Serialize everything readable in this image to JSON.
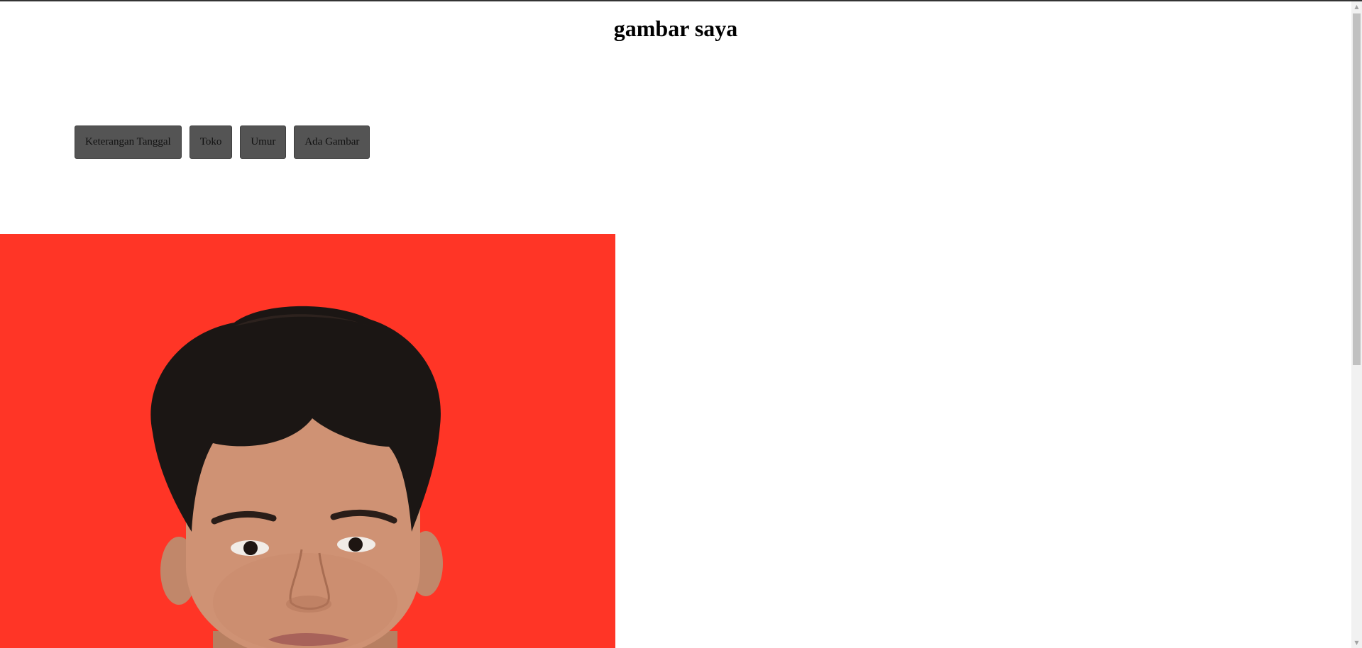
{
  "page": {
    "title": "gambar saya"
  },
  "nav": {
    "buttons": [
      {
        "label": "Keterangan Tanggal"
      },
      {
        "label": "Toko"
      },
      {
        "label": "Umur"
      },
      {
        "label": "Ada Gambar"
      }
    ]
  },
  "photo": {
    "background_color": "#ff3526"
  },
  "colors": {
    "button_bg": "#545454",
    "page_bg": "#ffffff"
  }
}
